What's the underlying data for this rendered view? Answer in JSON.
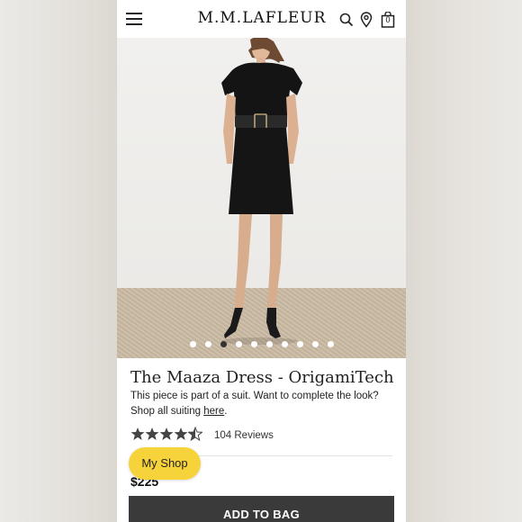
{
  "header": {
    "logo": "M.M.LAFLEUR",
    "bag_count": "0",
    "icons": [
      "menu-icon",
      "search-icon",
      "location-pin-icon",
      "shopping-bag-icon"
    ]
  },
  "carousel": {
    "slide_count": 10,
    "active_index": 2
  },
  "product": {
    "title": "The Maaza Dress - OrigamiTech",
    "description_line1": "This piece is part of a suit. Want to complete the look?",
    "description_prefix": "Shop all suiting ",
    "description_link": "here",
    "description_suffix": ".",
    "rating": 4.5,
    "rating_max": 5,
    "reviews_label": "104 Reviews",
    "price": "$225"
  },
  "actions": {
    "my_shop_label": "My Shop",
    "add_to_bag_label": "ADD TO BAG"
  },
  "colors": {
    "my_shop_bg": "#f6d33a",
    "add_to_bag_bg": "#3a3a3a",
    "star": "#444444"
  }
}
